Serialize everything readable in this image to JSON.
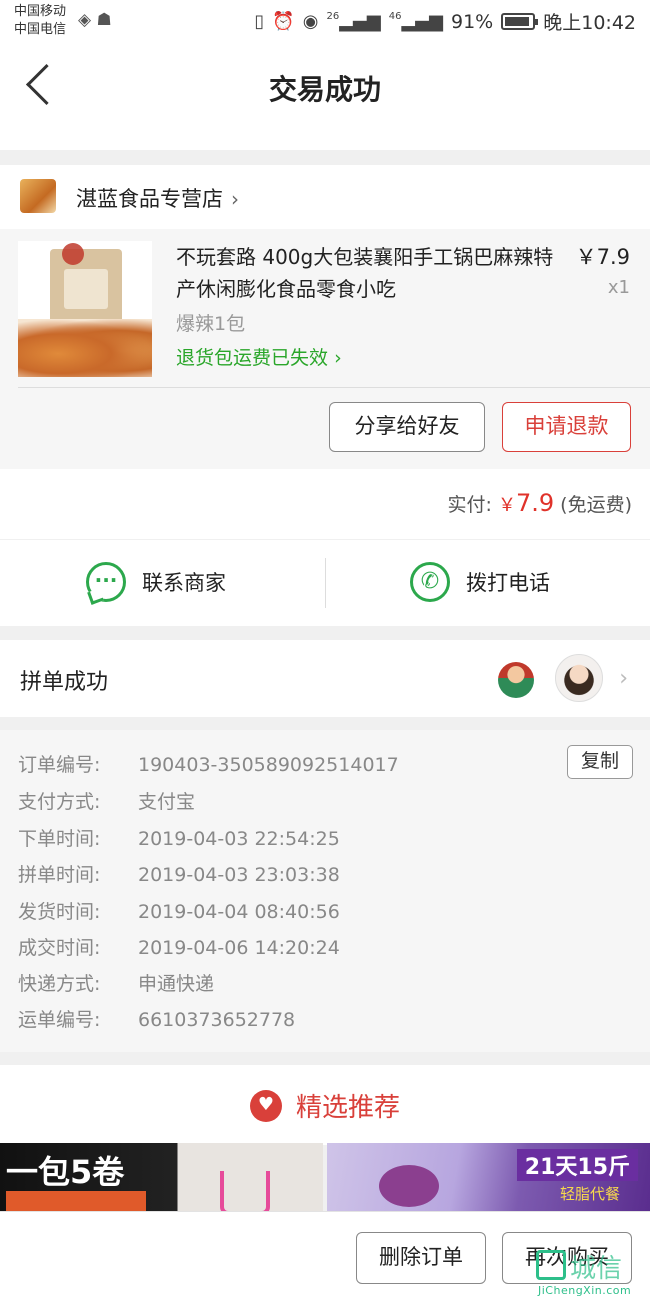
{
  "status_bar": {
    "carrier_1": "中国移动",
    "carrier_2": "中国电信",
    "network_1": "26",
    "network_2": "46",
    "battery": "91%",
    "battery_level": 0.91,
    "time": "晚上10:42"
  },
  "nav": {
    "title": "交易成功"
  },
  "shop": {
    "name": "湛蓝食品专营店"
  },
  "product": {
    "title": "不玩套路 400g大包装襄阳手工锅巴麻辣特产休闲膨化食品零食小吃",
    "price": "￥7.9",
    "quantity": "x1",
    "spec": "爆辣1包",
    "notice": "退货包运费已失效",
    "share_button": "分享给好友",
    "refund_button": "申请退款"
  },
  "payment": {
    "label": "实付:",
    "currency": "￥",
    "amount": "7.9",
    "note": "(免运费)"
  },
  "contact": {
    "merchant": "联系商家",
    "call": "拨打电话"
  },
  "group_buy": {
    "label": "拼单成功"
  },
  "order_details": {
    "copy_button": "复制",
    "rows": [
      {
        "key": "订单编号:",
        "value": "190403-350589092514017"
      },
      {
        "key": "支付方式:",
        "value": "支付宝"
      },
      {
        "key": "下单时间:",
        "value": "2019-04-03 22:54:25"
      },
      {
        "key": "拼单时间:",
        "value": "2019-04-03 23:03:38"
      },
      {
        "key": "发货时间:",
        "value": "2019-04-04 08:40:56"
      },
      {
        "key": "成交时间:",
        "value": "2019-04-06 14:20:24"
      },
      {
        "key": "快递方式:",
        "value": "申通快递"
      },
      {
        "key": "运单编号:",
        "value": "6610373652778"
      }
    ]
  },
  "recommend": {
    "title": "精选推荐",
    "banner_1_text": "一包5卷",
    "banner_2_text": "21天15斤",
    "banner_2_sub": "轻脂代餐"
  },
  "bottom": {
    "delete_button": "删除订单",
    "rebuy_button": "再次购买"
  },
  "watermark": {
    "text": "城信",
    "url": "JiChengXin.com"
  },
  "colors": {
    "accent_red": "#d9403a",
    "green": "#2ca84c",
    "notice_green": "#2aa62a"
  }
}
